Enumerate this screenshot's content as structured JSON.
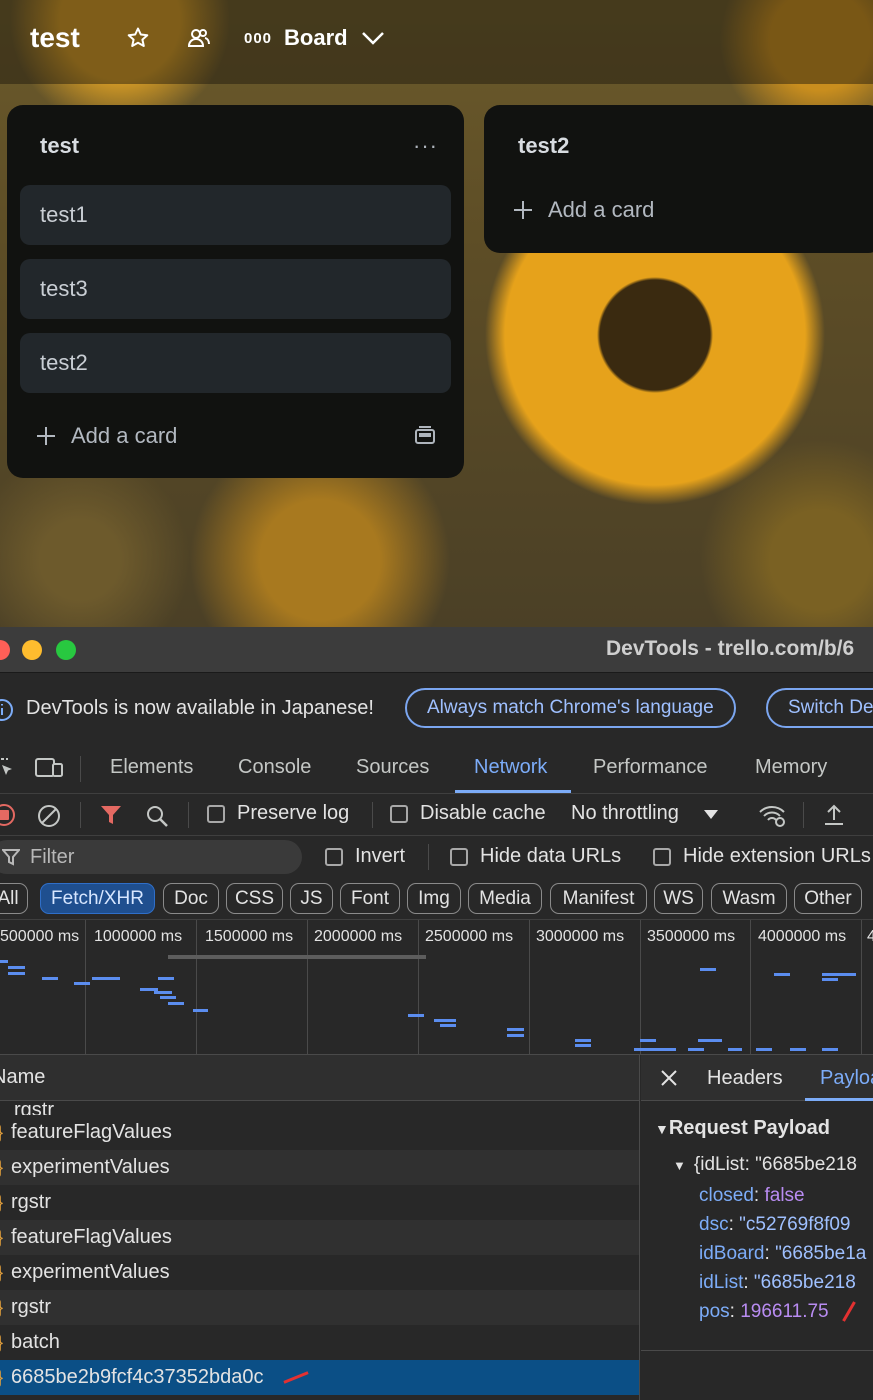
{
  "trello": {
    "board_title": "test",
    "view_label": "Board",
    "view_icon": "000",
    "lists": [
      {
        "title": "test",
        "menu": "···",
        "cards": [
          "test1",
          "test3",
          "test2"
        ],
        "add_card": "Add a card"
      },
      {
        "title": "test2",
        "cards": [],
        "add_card": "Add a card"
      }
    ]
  },
  "devtools": {
    "window_title": "DevTools - trello.com/b/6",
    "infobar": {
      "message": "DevTools is now available in Japanese!",
      "button_match": "Always match Chrome's language",
      "button_switch": "Switch De"
    },
    "tabs": [
      "Elements",
      "Console",
      "Sources",
      "Network",
      "Performance",
      "Memory"
    ],
    "active_tab": "Network",
    "toolbar": {
      "preserve_log": "Preserve log",
      "disable_cache": "Disable cache",
      "throttling": "No throttling"
    },
    "filter": {
      "placeholder": "Filter",
      "invert": "Invert",
      "hide_data_urls": "Hide data URLs",
      "hide_extension_urls": "Hide extension URLs"
    },
    "type_filters": [
      "All",
      "Fetch/XHR",
      "Doc",
      "CSS",
      "JS",
      "Font",
      "Img",
      "Media",
      "Manifest",
      "WS",
      "Wasm",
      "Other"
    ],
    "active_type_filter": "Fetch/XHR",
    "timeline_ticks": [
      "500000 ms",
      "1000000 ms",
      "1500000 ms",
      "2000000 ms",
      "2500000 ms",
      "3000000 ms",
      "3500000 ms",
      "4000000 ms",
      "4"
    ],
    "columns": {
      "name": "Name"
    },
    "requests": [
      "featureFlagValues",
      "experimentValues",
      "rgstr",
      "featureFlagValues",
      "experimentValues",
      "rgstr",
      "batch",
      "6685be2b9fcf4c37352bda0c"
    ],
    "selected_request": "6685be2b9fcf4c37352bda0c",
    "detail_tabs": {
      "headers": "Headers",
      "payload": "Payload"
    },
    "payload": {
      "section_title": "Request Payload",
      "summary": "{idList: \"6685be218",
      "fields": [
        {
          "key": "closed",
          "value": "false"
        },
        {
          "key": "dsc",
          "value": "\"c52769f8f09"
        },
        {
          "key": "idBoard",
          "value": "\"6685be1a"
        },
        {
          "key": "idList",
          "value": "\"6685be218"
        },
        {
          "key": "pos",
          "value": "196611.75"
        }
      ]
    },
    "colors": {
      "accent": "#7cacf8",
      "selected_row": "#0b4f86",
      "annotation": "#e33131"
    }
  }
}
